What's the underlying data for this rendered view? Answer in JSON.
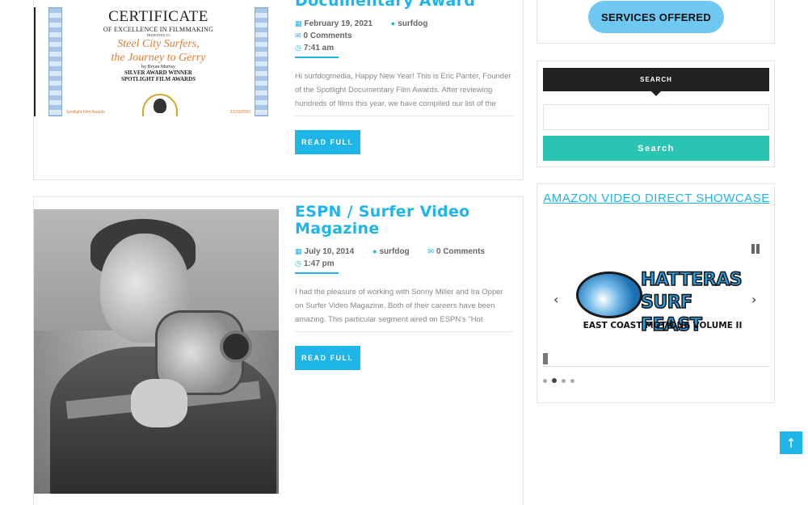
{
  "posts": [
    {
      "title": "Documentary Award",
      "date": "February 19, 2021",
      "author": "surfdog",
      "comments": "0 Comments",
      "time": "7:41 am",
      "excerpt": "Hi surfdogmedia, Happy New Year! This is Eric Panter, Founder of the Spotlight Documentary Film Awards. After reviewing hundreds of films this year, we have compiled our list of the",
      "read_label": "READ FULL",
      "certificate": {
        "heading": "CERTIFICATE",
        "subheading": "OF EXCELLENCE IN FILMMAKING",
        "presented_to": "PRESENTED TO",
        "org_line1": "Steel City Surfers,",
        "org_line2": "the Journey to Gerry",
        "by": "by Bryan Murray",
        "award1": "SILVER AWARD WINNER",
        "award2": "SPOTLIGHT FILM AWARDS",
        "foot_left": "Spotlight Film Awards",
        "foot_right": "12/29/2020",
        "presented_by": "PRESENTED BY",
        "date_label": "DATE"
      }
    },
    {
      "title": "ESPN / Surfer Video Magazine",
      "date": "July 10, 2014",
      "author": "surfdog",
      "comments": "0 Comments",
      "time": "1:47 pm",
      "excerpt": "I had the pleasure of working with Sonny Miller and Ira Opper  on Surfer Video Magazine. Both of their careers have been amazing. This particular segment aired on ESPN's \"Hot",
      "read_label": "READ FULL"
    }
  ],
  "sidebar": {
    "services_label": "SERVICES OFFERED",
    "search_heading": "SEARCH",
    "search_placeholder": "",
    "search_button": "Search",
    "amazon_title": "AMAZON VIDEO DIRECT SHOWCASE",
    "slide": {
      "line1": "HATTERAS",
      "line2": "SURF FEAST",
      "subtitle": "EAST COAST MOTIONS VOLUME II"
    },
    "slide_count": 4,
    "active_slide": 2
  },
  "icons": {
    "calendar": "calendar-icon",
    "author": "user-icon",
    "comments": "comments-icon",
    "clock": "clock-icon",
    "pause": "pause-icon",
    "prev": "chevron-left-icon",
    "next": "chevron-right-icon",
    "top": "arrow-up-icon"
  },
  "colors": {
    "accent": "#1fb5e8",
    "search_button": "#2ac4b2",
    "services_button": "#6ec8f2"
  }
}
